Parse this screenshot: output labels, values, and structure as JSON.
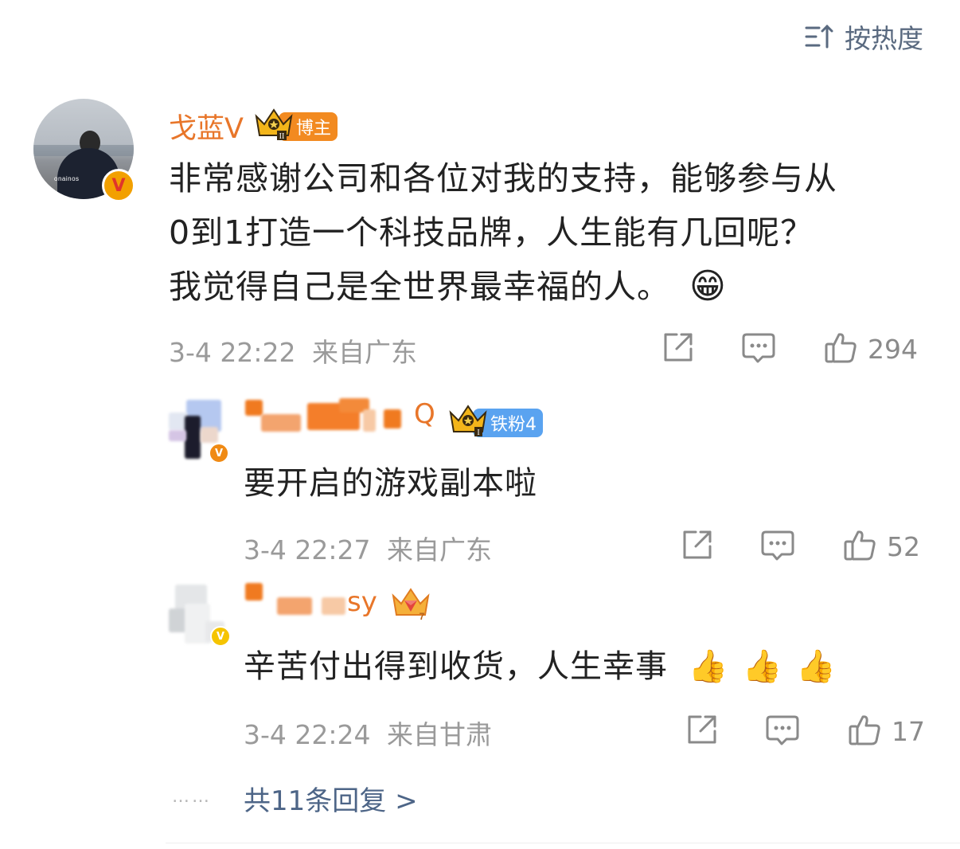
{
  "sort": {
    "label": "按热度"
  },
  "main_comment": {
    "user": "戈蓝V",
    "badge_label": "博主",
    "crown_level": "II",
    "text_lines": [
      "非常感谢公司和各位对我的支持，能够参与从",
      "0到1打造一个科技品牌，人生能有几回呢？",
      "我觉得自己是全世界最幸福的人。"
    ],
    "emoji": "😁",
    "time": "3-4 22:22",
    "location": "来自广东",
    "likes": "294",
    "avatar_text": "onainos"
  },
  "replies": [
    {
      "user": "Q",
      "badge_label": "铁粉4",
      "crown_level": "I",
      "text": "要开启的游戏副本啦",
      "time": "3-4 22:27",
      "location": "来自广东",
      "likes": "52"
    },
    {
      "user": "sy",
      "crown_level": "7",
      "text": "辛苦付出得到收货，人生幸事",
      "emoji": "👍👍👍",
      "time": "3-4 22:24",
      "location": "来自甘肃",
      "likes": "17"
    }
  ],
  "more_replies": {
    "label": "共11条回复 >",
    "dots": "……"
  },
  "colors": {
    "name": "#e8762a",
    "link": "#4d6587",
    "meta": "#9a9a9a",
    "blogger_tag": "#f28a20",
    "fan_tag": "#5aa3f0"
  }
}
